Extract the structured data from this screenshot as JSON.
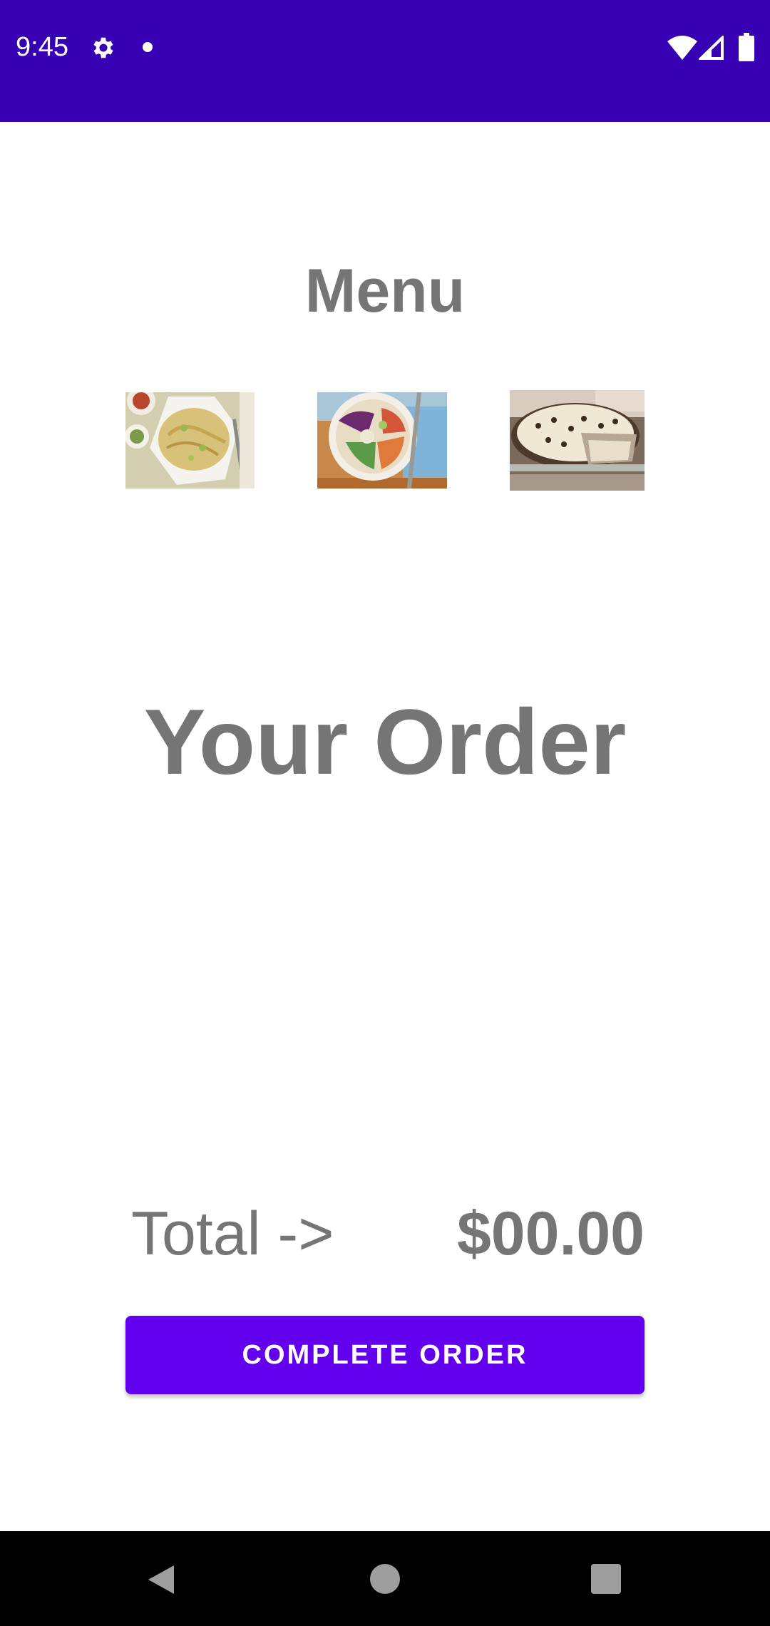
{
  "status_bar": {
    "time": "9:45",
    "icons": [
      "settings-gear-icon",
      "notification-dot-icon",
      "wifi-icon",
      "cell-signal-icon",
      "battery-icon"
    ],
    "background": "#3700B3"
  },
  "menu": {
    "title": "Menu",
    "items": [
      {
        "icon": "noodles-dish-image"
      },
      {
        "icon": "salad-bowl-image"
      },
      {
        "icon": "cream-pie-image"
      }
    ]
  },
  "order": {
    "title": "Your Order"
  },
  "total": {
    "label": "Total ->",
    "value": "$00.00"
  },
  "actions": {
    "complete_order_label": "COMPLETE ORDER",
    "button_color": "#6200EE"
  },
  "nav_bar": {
    "icons": [
      "back-icon",
      "home-icon",
      "recents-icon"
    ]
  },
  "colors": {
    "text_gray": "#757575",
    "accent": "#6200EE",
    "primary_dark": "#3700B3"
  }
}
